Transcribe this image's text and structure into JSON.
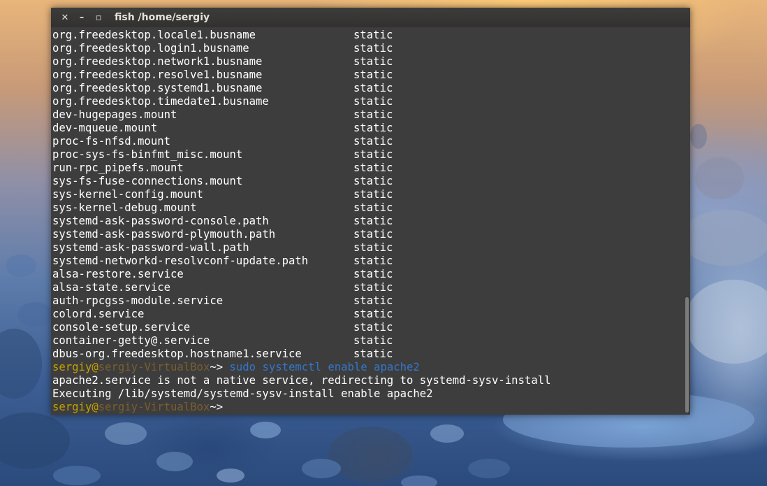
{
  "window": {
    "title": "fish  /home/sergiy",
    "buttons": {
      "close": "✕",
      "minimize": "–",
      "maximize": "▫"
    }
  },
  "terminal": {
    "units": [
      {
        "name": "org.freedesktop.locale1.busname",
        "state": "static"
      },
      {
        "name": "org.freedesktop.login1.busname",
        "state": "static"
      },
      {
        "name": "org.freedesktop.network1.busname",
        "state": "static"
      },
      {
        "name": "org.freedesktop.resolve1.busname",
        "state": "static"
      },
      {
        "name": "org.freedesktop.systemd1.busname",
        "state": "static"
      },
      {
        "name": "org.freedesktop.timedate1.busname",
        "state": "static"
      },
      {
        "name": "dev-hugepages.mount",
        "state": "static"
      },
      {
        "name": "dev-mqueue.mount",
        "state": "static"
      },
      {
        "name": "proc-fs-nfsd.mount",
        "state": "static"
      },
      {
        "name": "proc-sys-fs-binfmt_misc.mount",
        "state": "static"
      },
      {
        "name": "run-rpc_pipefs.mount",
        "state": "static"
      },
      {
        "name": "sys-fs-fuse-connections.mount",
        "state": "static"
      },
      {
        "name": "sys-kernel-config.mount",
        "state": "static"
      },
      {
        "name": "sys-kernel-debug.mount",
        "state": "static"
      },
      {
        "name": "systemd-ask-password-console.path",
        "state": "static"
      },
      {
        "name": "systemd-ask-password-plymouth.path",
        "state": "static"
      },
      {
        "name": "systemd-ask-password-wall.path",
        "state": "static"
      },
      {
        "name": "systemd-networkd-resolvconf-update.path",
        "state": "static"
      },
      {
        "name": "alsa-restore.service",
        "state": "static"
      },
      {
        "name": "alsa-state.service",
        "state": "static"
      },
      {
        "name": "auth-rpcgss-module.service",
        "state": "static"
      },
      {
        "name": "colord.service",
        "state": "static"
      },
      {
        "name": "console-setup.service",
        "state": "static"
      },
      {
        "name": "container-getty@.service",
        "state": "static"
      },
      {
        "name": "dbus-org.freedesktop.hostname1.service",
        "state": "static"
      }
    ],
    "prompt": {
      "user": "sergiy",
      "at": "@",
      "host": "sergiy-VirtualBox",
      "path": "~",
      "symbol": "> "
    },
    "command": "sudo systemctl enable apache2",
    "output": [
      "apache2.service is not a native service, redirecting to systemd-sysv-install",
      "Executing /lib/systemd/systemd-sysv-install enable apache2"
    ],
    "colors": {
      "background": "#3d3d3d",
      "text": "#ffffff",
      "user": "#c4a000",
      "host": "#7a5e2e",
      "command": "#3476c8"
    }
  }
}
